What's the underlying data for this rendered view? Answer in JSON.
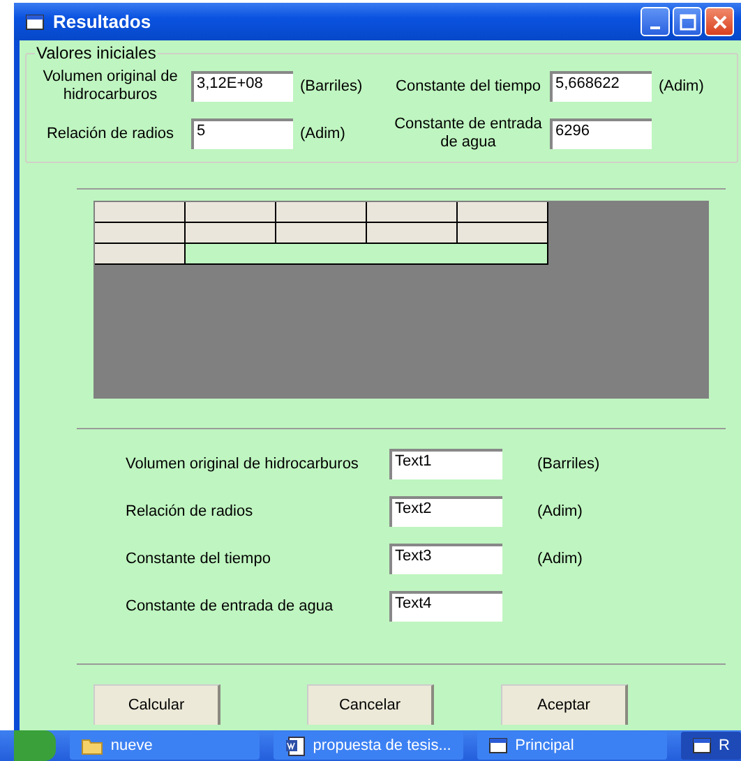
{
  "window": {
    "title": "Resultados"
  },
  "initial_values": {
    "title": "Valores iniciales",
    "fields": [
      {
        "label": "Volumen original de hidrocarburos",
        "value": "3,12E+08",
        "unit": "(Barriles)"
      },
      {
        "label": "Constante del tiempo",
        "value": "5,668622",
        "unit": "(Adim)"
      },
      {
        "label": "Relación de radios",
        "value": "5",
        "unit": "(Adim)"
      },
      {
        "label": "Constante de entrada de agua",
        "value": "6296"
      }
    ]
  },
  "results": [
    {
      "label": "Volumen original de hidrocarburos",
      "value": "Text1",
      "unit": "(Barriles)"
    },
    {
      "label": "Relación de radios",
      "value": "Text2",
      "unit": "(Adim)"
    },
    {
      "label": "Constante del tiempo",
      "value": "Text3",
      "unit": "(Adim)"
    },
    {
      "label": "Constante de entrada de agua",
      "value": "Text4"
    }
  ],
  "buttons": [
    "Calcular",
    "Cancelar",
    "Aceptar"
  ],
  "taskbar": [
    {
      "label": "nueve",
      "kind": "folder",
      "selected": false
    },
    {
      "label": "propuesta de tesis...",
      "kind": "document",
      "selected": false
    },
    {
      "label": "Principal",
      "kind": "window",
      "selected": false
    },
    {
      "label": "R",
      "kind": "window",
      "selected": true
    }
  ]
}
